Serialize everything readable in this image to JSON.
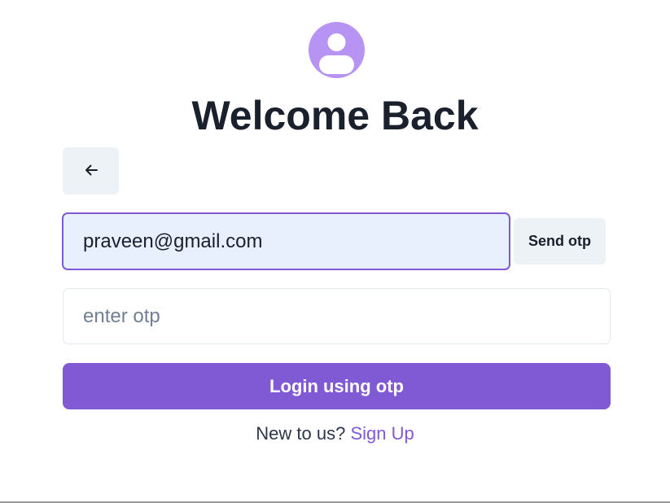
{
  "header": {
    "avatar_icon": "user-avatar-icon",
    "title": "Welcome Back"
  },
  "back_button": {
    "icon": "arrow-left-icon"
  },
  "email": {
    "value": "praveen@gmail.com",
    "send_label": "Send otp"
  },
  "otp": {
    "value": "",
    "placeholder": "enter otp"
  },
  "login": {
    "label": "Login using otp"
  },
  "signup": {
    "prompt": "New to us?",
    "link_label": "Sign Up"
  },
  "colors": {
    "accent": "#805ad5",
    "avatar": "#b794f4",
    "button_gray": "#edf2f7",
    "input_autofill": "#e8f0fe",
    "title": "#1a202c"
  }
}
